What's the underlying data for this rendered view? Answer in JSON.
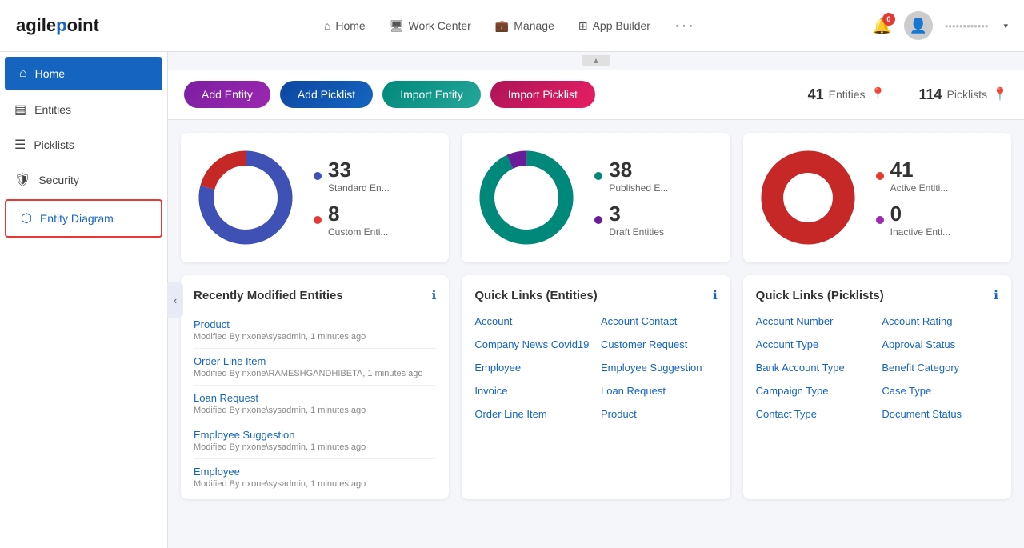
{
  "logo": {
    "text1": "agilepoint"
  },
  "topnav": {
    "home_label": "Home",
    "workcenter_label": "Work Center",
    "manage_label": "Manage",
    "appbuilder_label": "App Builder",
    "notif_count": "0",
    "user_display": "••••••••••••"
  },
  "sidebar": {
    "items": [
      {
        "id": "home",
        "label": "Home",
        "icon": "⌂",
        "active": true
      },
      {
        "id": "entities",
        "label": "Entities",
        "icon": "▤",
        "active": false
      },
      {
        "id": "picklists",
        "label": "Picklists",
        "icon": "☰",
        "active": false
      },
      {
        "id": "security",
        "label": "Security",
        "icon": "🛡",
        "active": false
      },
      {
        "id": "entity-diagram",
        "label": "Entity Diagram",
        "icon": "⬡",
        "active": false,
        "selected": true
      }
    ]
  },
  "toolbar": {
    "add_entity_label": "Add Entity",
    "add_picklist_label": "Add Picklist",
    "import_entity_label": "Import Entity",
    "import_picklist_label": "Import Picklist",
    "entities_count": "41",
    "entities_label": "Entities",
    "picklists_count": "114",
    "picklists_label": "Picklists"
  },
  "charts": [
    {
      "id": "entities-type",
      "segments": [
        {
          "label": "Standard En...",
          "count": "33",
          "color": "#3f51b5",
          "pct": 80
        },
        {
          "label": "Custom Enti...",
          "count": "8",
          "color": "#e53935",
          "pct": 20
        }
      ],
      "donut_colors": [
        "#3f51b5",
        "#c62828"
      ]
    },
    {
      "id": "entities-status",
      "segments": [
        {
          "label": "Published E...",
          "count": "38",
          "color": "#00897b",
          "pct": 93
        },
        {
          "label": "Draft Entities",
          "count": "3",
          "color": "#6a1b9a",
          "pct": 7
        }
      ],
      "donut_colors": [
        "#00897b",
        "#6a1b9a"
      ]
    },
    {
      "id": "entities-active",
      "segments": [
        {
          "label": "Active Entiti...",
          "count": "41",
          "color": "#e53935",
          "pct": 100
        },
        {
          "label": "Inactive Enti...",
          "count": "0",
          "color": "#9c27b0",
          "pct": 0
        }
      ],
      "donut_colors": [
        "#c62828",
        "#7b1fa2"
      ]
    }
  ],
  "recently_modified": {
    "title": "Recently Modified Entities",
    "items": [
      {
        "name": "Product",
        "meta": "Modified By nxone\\sysadmin, 1 minutes ago"
      },
      {
        "name": "Order Line Item",
        "meta": "Modified By nxone\\RAMESHGANDHIBETA, 1 minutes ago"
      },
      {
        "name": "Loan Request",
        "meta": "Modified By nxone\\sysadmin, 1 minutes ago"
      },
      {
        "name": "Employee Suggestion",
        "meta": "Modified By nxone\\sysadmin, 1 minutes ago"
      },
      {
        "name": "Employee",
        "meta": "Modified By nxone\\sysadmin, 1 minutes ago"
      }
    ]
  },
  "quick_links_entities": {
    "title": "Quick Links (Entities)",
    "links": [
      "Account",
      "Account Contact",
      "Company News Covid19",
      "Customer Request",
      "Employee",
      "Employee Suggestion",
      "Invoice",
      "Loan Request",
      "Order Line Item",
      "Product"
    ]
  },
  "quick_links_picklists": {
    "title": "Quick Links (Picklists)",
    "links": [
      "Account Number",
      "Account Rating",
      "Account Type",
      "Approval Status",
      "Bank Account Type",
      "Benefit Category",
      "Campaign Type",
      "Case Type",
      "Contact Type",
      "Document Status"
    ]
  }
}
